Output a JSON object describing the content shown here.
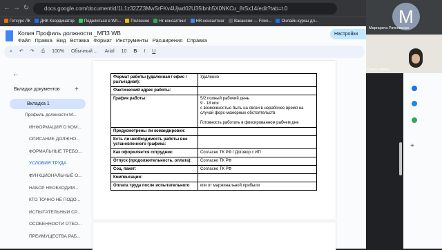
{
  "browser": {
    "url": "docs.google.com/document/d/1L1z32ZZ3MwSrFKv4Ujwd02U35lbnh5X0NKCu_8rSx14/edit?tab=t.0",
    "bookmarks": [
      "Гетхурс ЛК",
      "ДНК Координатор",
      "Поделиться в Wh...",
      "Полезное",
      "Hr-консалтинг",
      "НR-консалтинг",
      "Вакансии — Frien...",
      "Онлайн-курсы дл..."
    ]
  },
  "doc": {
    "title": "Копия Профиль должности _МПЗ WB",
    "menu": [
      "Файл",
      "Правка",
      "Вид",
      "Вставка",
      "Формат",
      "Инструменты",
      "Расширения",
      "Справка"
    ],
    "settings": "Настройки"
  },
  "toolbar": {
    "zoom": "100%",
    "style": "Обычный ...",
    "font": "Arial",
    "size": "10"
  },
  "sidebar": {
    "header": "Вкладки документов",
    "tab": "Вкладка 1",
    "items": [
      "Профиль должности М...",
      "ИНФОРМАЦИЯ О КОМ...",
      "ОПИСАНИЕ ДОЛЖНО...",
      "ФОРМАЛЬНЫЕ ТРЕБО...",
      "УСЛОВИЯ ТРУДА",
      "ФУНКЦИОНАЛЬНЫЕ О...",
      "НАБОР НЕОБХОДИМ...",
      "КТО ТОЧНО НЕ ПОДО...",
      "ИСПЫТАТЕЛЬНЫЙ СР...",
      "ОСОБЕННОСТИ ОТБО...",
      "ПРЕИМУЩЕСТВА РАБ..."
    ]
  },
  "table": {
    "rows": [
      {
        "label": "Формат работы (удаленная / офис / разъездная):",
        "value": "Удаленно"
      },
      {
        "label": "Фактический адрес работы:",
        "value": ""
      },
      {
        "label": "График работы:",
        "value": "5/2 полный рабочий день\n9 - 18 мск\nс возможностью быть на связи в нерабочее время на случай форс-мажорных обстоятельств\n\nГотовность работать в фиксированном рабчем дне"
      },
      {
        "label": "Предусмотрены ли командировки:",
        "value": ""
      },
      {
        "label": "Есть ли необходимость работы вне установленного графика:",
        "value": ""
      },
      {
        "label": "Как оформляется сотрудник:",
        "value": "Согласно ТК РФ / Договор с ИП"
      },
      {
        "label": "Отпуск (продолжительность, оплата):",
        "value": "Согласно ТК РФ"
      },
      {
        "label": "Соц. пакет:",
        "value": "Согласно ТК РФ"
      },
      {
        "label": "Компенсации:",
        "value": ""
      },
      {
        "label": "Оплата труда после испытательного",
        "value": "кпи от маржинальной прибыли"
      }
    ]
  },
  "video": {
    "avatar": "М",
    "name1": "Маргарита Рачковская",
    "name2": "Олеся Меер"
  }
}
